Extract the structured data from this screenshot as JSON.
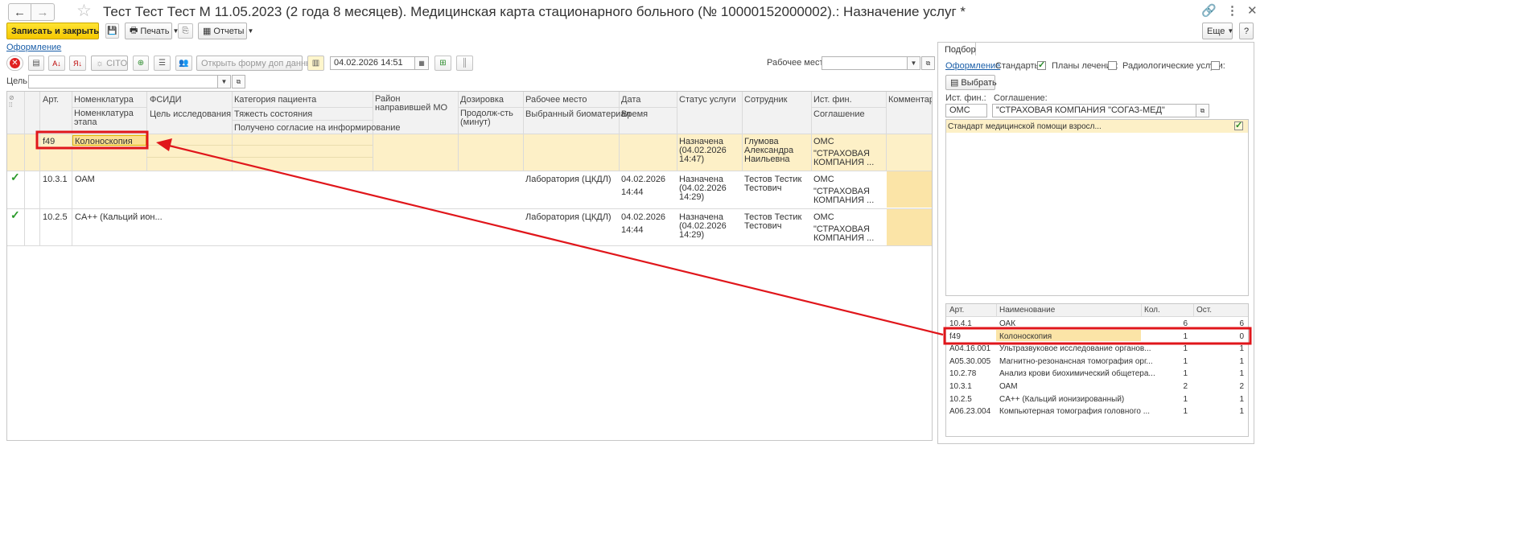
{
  "window": {
    "title": "Тест Тест Тест М 11.05.2023 (2 года 8 месяцев). Медицинская карта стационарного больного (№ 10000152000002).: Назначение услуг *"
  },
  "toolbar": {
    "save_close": "Записать и закрыть",
    "print": "Печать",
    "reports": "Отчеты",
    "more": "Еще",
    "help": "?"
  },
  "form_link": "Оформление",
  "actions": {
    "cito": "CITO",
    "open_form": "Открыть форму доп данных",
    "datetime": "04.02.2026 14:51",
    "workplace_label": "Рабочее место:",
    "workplace_value": ""
  },
  "goal": {
    "label": "Цель:",
    "value": ""
  },
  "table": {
    "headers": {
      "art": "Арт.",
      "nomen": "Номенклатура",
      "nomen_stage": "Номенклатура этапа",
      "fsidi": "ФСИДИ",
      "goal": "Цель исследования",
      "category": "Категория пациента",
      "severity": "Тяжесть состояния",
      "consent": "Получено согласие на информирование",
      "district": "Район направившей МО",
      "dosage": "Дозировка",
      "duration": "Продолж-сть (минут)",
      "workplace": "Рабочее место",
      "biomaterial": "Выбранный биоматериал",
      "date": "Дата",
      "time": "Время",
      "status": "Статус услуги",
      "employee": "Сотрудник",
      "fin": "Ист. фин.",
      "agreement": "Соглашение",
      "comment": "Комментарий"
    },
    "rows": [
      {
        "check": "",
        "art": "f49",
        "nomen": "Колоноскопия",
        "workplace": "",
        "date": "",
        "time": "",
        "status": "Назначена (04.02.2026 14:47)",
        "employee": "Глумова Александра Наильевна",
        "fin": "ОМС",
        "agreement": "\"СТРАХОВАЯ КОМПАНИЯ ..."
      },
      {
        "check": "✓",
        "art": "10.3.1",
        "nomen": "ОАМ",
        "workplace": "Лаборатория (ЦКДЛ)",
        "date": "04.02.2026",
        "time": "14:44",
        "status": "Назначена (04.02.2026 14:29)",
        "employee": "Тестов Тестик Тестович",
        "fin": "ОМС",
        "agreement": "\"СТРАХОВАЯ КОМПАНИЯ ..."
      },
      {
        "check": "✓",
        "art": "10.2.5",
        "nomen": "CA++ (Кальций ион...",
        "workplace": "Лаборатория (ЦКДЛ)",
        "date": "04.02.2026",
        "time": "14:44",
        "status": "Назначена (04.02.2026 14:29)",
        "employee": "Тестов Тестик Тестович",
        "fin": "ОМС",
        "agreement": "\"СТРАХОВАЯ КОМПАНИЯ ..."
      }
    ]
  },
  "side": {
    "tab": "Подбор",
    "form_link": "Оформление",
    "standards_label": "Стандарты:",
    "plans_label": "Планы лечения:",
    "radiology_label": "Радиологические услуги:",
    "select_btn": "Выбрать",
    "fin_label": "Ист. фин.:",
    "fin_value": "ОМС",
    "agreement_label": "Соглашение:",
    "agreement_value": "\"СТРАХОВАЯ КОМПАНИЯ \"СОГАЗ-МЕД\"",
    "standard_item": "Стандарт медицинской помощи взросл...",
    "headers": {
      "art": "Арт.",
      "name": "Наименование",
      "qty": "Кол.",
      "rest": "Ост."
    },
    "rows": [
      {
        "art": "10.4.1",
        "name": "ОАК",
        "qty": "6",
        "rest": "6"
      },
      {
        "art": "f49",
        "name": "Колоноскопия",
        "qty": "1",
        "rest": "0"
      },
      {
        "art": "A04.16.001",
        "name": "Ультразвуковое исследование органов...",
        "qty": "1",
        "rest": "1"
      },
      {
        "art": "A05.30.005",
        "name": "Магнитно-резонансная томография орг...",
        "qty": "1",
        "rest": "1"
      },
      {
        "art": "10.2.78",
        "name": "Анализ крови биохимический общетера...",
        "qty": "1",
        "rest": "1"
      },
      {
        "art": "10.3.1",
        "name": "ОАМ",
        "qty": "2",
        "rest": "2"
      },
      {
        "art": "10.2.5",
        "name": "CA++ (Кальций ионизированный)",
        "qty": "1",
        "rest": "1"
      },
      {
        "art": "A06.23.004",
        "name": "Компьютерная томография головного ...",
        "qty": "1",
        "rest": "1"
      }
    ]
  },
  "colors": {
    "accent": "#f5c800",
    "selected_row": "#fdf0c7",
    "highlight_cell": "#fbe4a7",
    "annotation": "#e0161b"
  }
}
